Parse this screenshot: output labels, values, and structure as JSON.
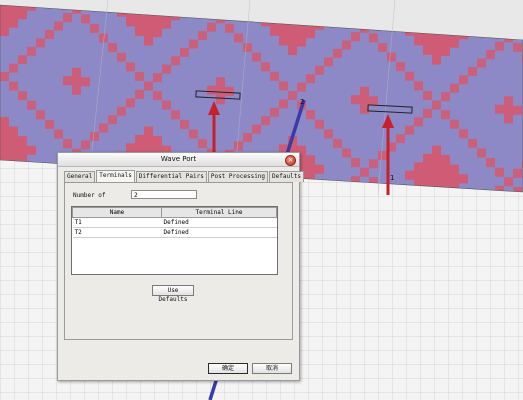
{
  "dialog": {
    "title": "Wave Port",
    "tabs": [
      "General",
      "Terminals",
      "Differential Pairs",
      "Post Processing",
      "Defaults"
    ],
    "active_tab": "Terminals",
    "number_of_label": "Number of",
    "number_of_value": "2",
    "table": {
      "headers": [
        "Name",
        "Terminal Line"
      ],
      "rows": [
        {
          "name": "T1",
          "terminal_line": "Defined"
        },
        {
          "name": "T2",
          "terminal_line": "Defined"
        }
      ]
    },
    "use_defaults_label": "Use Defaults",
    "ok_label": "确定",
    "cancel_label": "取消"
  },
  "viewport": {
    "labels": {
      "port_2": "2",
      "port_1": "1"
    },
    "colors": {
      "pattern_blue": "#8c89c6",
      "pattern_red": "#d35a70",
      "arrow_red": "#c8202a",
      "line_blue": "#3a3aa8",
      "grid_bg": "#f4f4f4"
    }
  }
}
